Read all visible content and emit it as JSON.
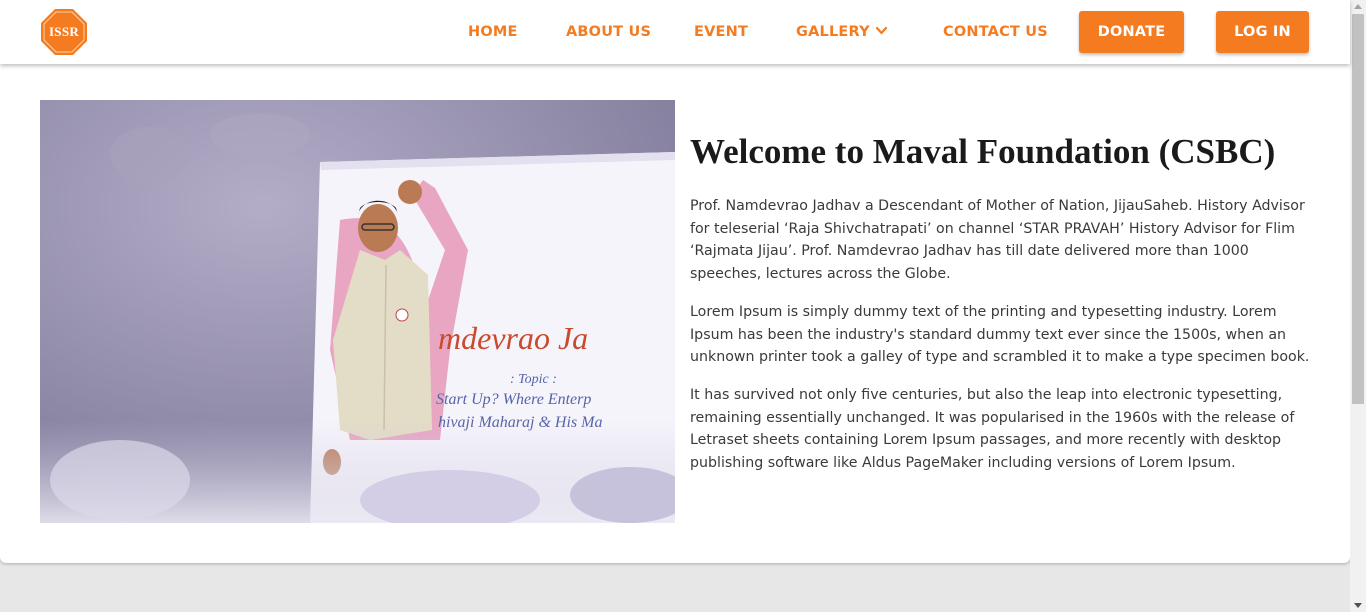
{
  "brand": {
    "logo_text": "ISSR",
    "accent": "#f47b20"
  },
  "nav": {
    "items": [
      {
        "label": "HOME"
      },
      {
        "label": "ABOUT US"
      },
      {
        "label": "EVENT"
      },
      {
        "label": "GALLERY",
        "icon": "chevron-down-icon"
      },
      {
        "label": "CONTACT US"
      }
    ],
    "donate_label": "DONATE",
    "login_label": "LOG IN"
  },
  "hero": {
    "photo": {
      "banner_name": "mdevrao Ja",
      "banner_topic": ": Topic :",
      "banner_line1": "Start Up? Where Enterp",
      "banner_line2": "hivaji Maharaj & His Ma"
    },
    "title": "Welcome to Maval Foundation (CSBC)",
    "paragraphs": [
      "Prof. Namdevrao Jadhav a Descendant of Mother of Nation, JijauSaheb. History Advisor for teleserial ‘Raja Shivchatrapati’ on channel ‘STAR PRAVAH’ History Advisor for Flim ‘Rajmata Jijau’. Prof. Namdevrao Jadhav has till date delivered more than 1000 speeches, lectures across the Globe.",
      "Lorem Ipsum is simply dummy text of the printing and typesetting industry. Lorem Ipsum has been the industry's standard dummy text ever since the 1500s, when an unknown printer took a galley of type and scrambled it to make a type specimen book.",
      "It has survived not only five centuries, but also the leap into electronic typesetting, remaining essentially unchanged. It was popularised in the 1960s with the release of Letraset sheets containing Lorem Ipsum passages, and more recently with desktop publishing software like Aldus PageMaker including versions of Lorem Ipsum."
    ]
  }
}
